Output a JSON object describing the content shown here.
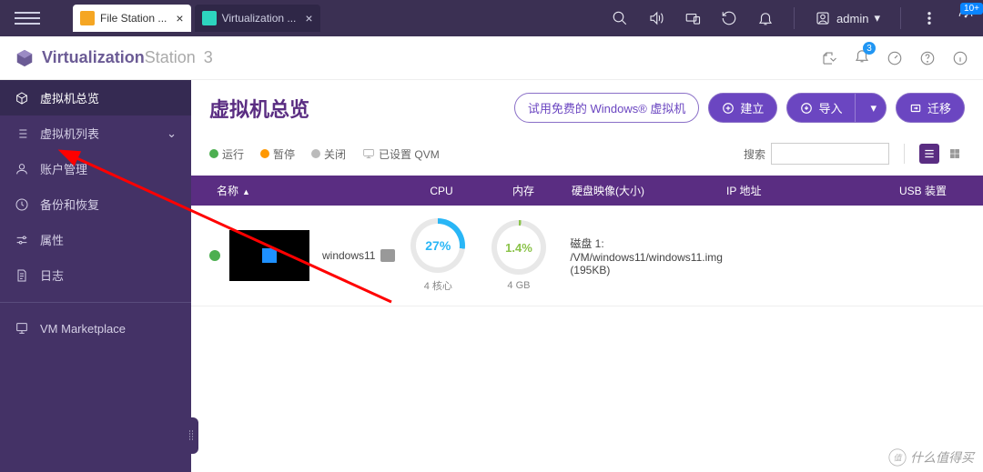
{
  "os": {
    "tabs": [
      {
        "label": "File Station ...",
        "active": false,
        "iconColor": "#f5a623"
      },
      {
        "label": "Virtualization ...",
        "active": true,
        "iconColor": "#2dd4bf"
      }
    ],
    "user": "admin",
    "dash_badge": "10+"
  },
  "app": {
    "title1": "Virtualization",
    "title2": "Station",
    "title3": "3",
    "bell_count": "3"
  },
  "sidebar": {
    "items": [
      {
        "label": "虚拟机总览",
        "icon": "cube",
        "active": true
      },
      {
        "label": "虚拟机列表",
        "icon": "list",
        "expandable": true
      },
      {
        "label": "账户管理",
        "icon": "user"
      },
      {
        "label": "备份和恢复",
        "icon": "clock"
      },
      {
        "label": "属性",
        "icon": "sliders"
      },
      {
        "label": "日志",
        "icon": "file"
      }
    ],
    "market": "VM Marketplace"
  },
  "page": {
    "title": "虚拟机总览",
    "actions": {
      "trial": "试用免费的 Windows® 虚拟机",
      "create": "建立",
      "import": "导入",
      "migrate": "迁移"
    },
    "legend": {
      "running": "运行",
      "paused": "暂停",
      "stopped": "关闭",
      "qvm": "已设置 QVM"
    },
    "search": {
      "label": "搜索",
      "placeholder": ""
    }
  },
  "table": {
    "headers": {
      "name": "名称",
      "cpu": "CPU",
      "mem": "内存",
      "disk": "硬盘映像(大小)",
      "ip": "IP 地址",
      "usb": "USB 装置"
    }
  },
  "vm": {
    "name": "windows11",
    "cpu_pct": "27%",
    "cpu_sub": "4 核心",
    "mem_pct": "1.4%",
    "mem_sub": "4 GB",
    "disk_label": "磁盘 1:",
    "disk_path": "/VM/windows11/windows11.img (195KB)"
  },
  "watermark": "什么值得买"
}
